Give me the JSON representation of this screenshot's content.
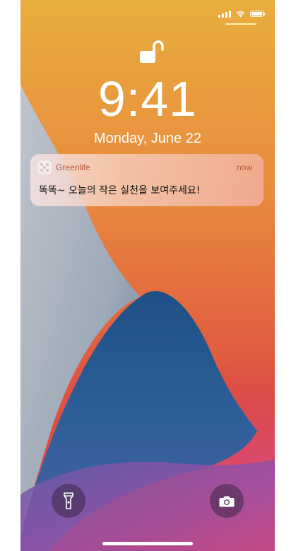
{
  "lockscreen": {
    "time": "9:41",
    "date": "Monday, June 22"
  },
  "notification": {
    "app_name": "Greenlife",
    "time": "now",
    "message": "똑똑~ 오늘의 작은 실천을 보여주세요!",
    "app_icon": "greenlife-app-icon"
  },
  "status_bar": {
    "icons": [
      "cellular-signal-icon",
      "wifi-icon",
      "battery-icon"
    ],
    "battery_level": 1.0
  },
  "controls": {
    "left_icon": "flashlight-icon",
    "right_icon": "camera-icon"
  },
  "colors": {
    "notification_accent": "#b4543a",
    "wallpaper_orange": "#e8a23c",
    "wallpaper_red": "#d9463a",
    "wallpaper_blue": "#2d5a8c",
    "wallpaper_gray": "#9aa7b8"
  }
}
